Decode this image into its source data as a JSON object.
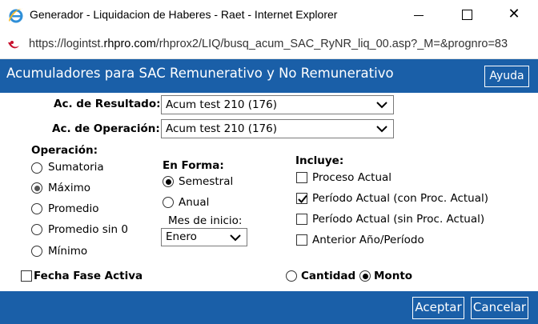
{
  "window": {
    "title": "Generador - Liquidacion de Haberes - Raet - Internet Explorer",
    "close_glyph": "✕"
  },
  "address": {
    "url_prefix": "https://logintst.",
    "url_domain": "rhpro.com",
    "url_suffix": "/rhprox2/LIQ/busq_acum_SAC_RyNR_liq_00.asp?_M=&prognro=83"
  },
  "header": {
    "title": "Acumuladores para SAC Remunerativo y No Remunerativo",
    "help_label": "Ayuda"
  },
  "form": {
    "resultado_label": "Ac. de Resultado:",
    "resultado_value": "Acum test 210 (176)",
    "operacion_ac_label": "Ac. de Operación:",
    "operacion_ac_value": "Acum test 210 (176)",
    "operacion": {
      "label": "Operación:",
      "options": [
        "Sumatoria",
        "Máximo",
        "Promedio",
        "Promedio sin 0",
        "Mínimo"
      ],
      "selected": "Máximo"
    },
    "forma": {
      "label": "En Forma:",
      "options": [
        "Semestral",
        "Anual"
      ],
      "selected": "Semestral",
      "mes_label": "Mes de inicio:",
      "mes_value": "Enero"
    },
    "incluye": {
      "label": "Incluye:",
      "options": [
        {
          "label": "Proceso Actual",
          "checked": false
        },
        {
          "label": "Período Actual (con Proc. Actual)",
          "checked": true
        },
        {
          "label": "Período Actual (sin Proc. Actual)",
          "checked": false
        },
        {
          "label": "Anterior Año/Período",
          "checked": false
        }
      ]
    },
    "fecha_fase_label": "Fecha Fase Activa",
    "cantidad_label": "Cantidad",
    "monto_label": "Monto",
    "cantidad_monto_selected": "Monto"
  },
  "footer": {
    "accept_label": "Aceptar",
    "cancel_label": "Cancelar"
  },
  "colors": {
    "header_bg": "#1a5fa8",
    "ie_icon": "#2f8fd8"
  }
}
